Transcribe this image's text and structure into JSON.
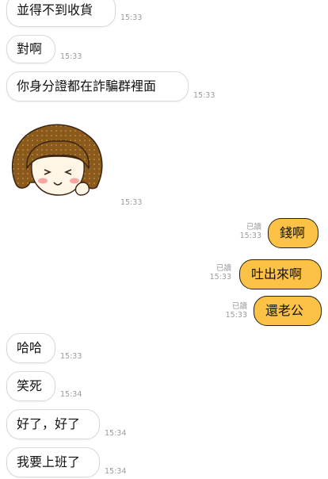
{
  "messages": [
    {
      "side": "in",
      "text": "並得不到收貨",
      "time": "15:33"
    },
    {
      "side": "in",
      "text": "對啊",
      "time": "15:33"
    },
    {
      "side": "in",
      "text": "你身分證都在詐騙群裡面",
      "time": "15:33"
    },
    {
      "side": "in",
      "type": "sticker",
      "sticker": "girl-bob-hair-sticker",
      "time": "15:33"
    },
    {
      "side": "out",
      "text": "錢啊",
      "read": "已讀",
      "time": "15:33"
    },
    {
      "side": "out",
      "text": "吐出來啊",
      "read": "已讀",
      "time": "15:33"
    },
    {
      "side": "out",
      "text": "還老公",
      "read": "已讀",
      "time": "15:33"
    },
    {
      "side": "in",
      "text": "哈哈",
      "time": "15:33"
    },
    {
      "side": "in",
      "text": "笑死",
      "time": "15:34"
    },
    {
      "side": "in",
      "text": "好了，好了",
      "time": "15:34"
    },
    {
      "side": "in",
      "text": "我要上班了",
      "time": "15:34"
    }
  ],
  "colors": {
    "outgoing_bubble": "#fcc245",
    "outgoing_border": "#2b1f0f",
    "incoming_bubble": "#ffffff",
    "timestamp": "#9b9b9b"
  }
}
